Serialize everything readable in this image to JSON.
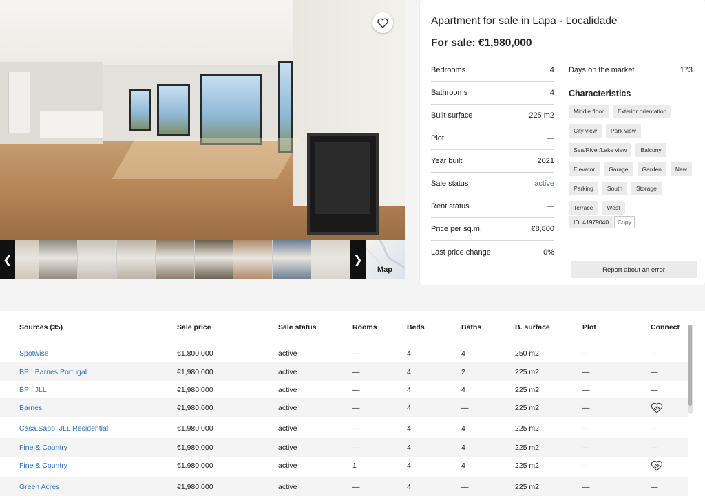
{
  "listing": {
    "title": "Apartment for sale in Lapa - Localidade",
    "price": "For sale: €1,980,000",
    "facts": [
      {
        "label": "Bedrooms",
        "value": "4"
      },
      {
        "label": "Bathrooms",
        "value": "4"
      },
      {
        "label": "Built surface",
        "value": "225 m2"
      },
      {
        "label": "Plot",
        "value": "—"
      },
      {
        "label": "Year built",
        "value": "2021"
      },
      {
        "label": "Sale status",
        "value": "active"
      },
      {
        "label": "Rent status",
        "value": "—"
      },
      {
        "label": "Price per sq.m.",
        "value": "€8,800"
      },
      {
        "label": "Last price change",
        "value": "0%"
      }
    ],
    "days_on_market": {
      "label": "Days on the market",
      "value": "173"
    },
    "characteristics_title": "Characteristics",
    "characteristics": [
      "Middle floor",
      "Exterior orientation",
      "City view",
      "Park view",
      "Sea/River/Lake view",
      "Balcony",
      "Elevator",
      "Garage",
      "Garden",
      "New",
      "Parking",
      "South",
      "Storage",
      "Terrace",
      "West"
    ],
    "id_label": "ID: 41979040",
    "copy_label": "Copy",
    "report_label": "Report about an error",
    "link_color": "#2f72c4"
  },
  "gallery": {
    "map_label": "Map",
    "prev_icon": "chevron-left-icon",
    "next_icon": "chevron-right-icon",
    "favorite_icon": "heart-icon",
    "thumb_colors": [
      "#cfc6b8",
      "#8f8a7f",
      "#c7c2b8",
      "#b9b2a4",
      "#8a7b66",
      "#6b5f50",
      "#b08a6a",
      "#6c7f92",
      "#d8d4cc"
    ]
  },
  "sources": {
    "headers": [
      "Sources (35)",
      "Sale price",
      "Sale status",
      "Rooms",
      "Beds",
      "Baths",
      "B. surface",
      "Plot",
      "Connect"
    ],
    "rows": [
      {
        "name": "Spotwise",
        "price": "€1,800,000",
        "status": "active",
        "rooms": "—",
        "beds": "4",
        "baths": "4",
        "surface": "250 m2",
        "plot": "—",
        "connect": "—"
      },
      {
        "name": "BPI: Barnes Portugal",
        "price": "€1,980,000",
        "status": "active",
        "rooms": "—",
        "beds": "4",
        "baths": "2",
        "surface": "225 m2",
        "plot": "—",
        "connect": "—"
      },
      {
        "name": "BPI: JLL",
        "price": "€1,980,000",
        "status": "active",
        "rooms": "—",
        "beds": "4",
        "baths": "4",
        "surface": "225 m2",
        "plot": "—",
        "connect": "—"
      },
      {
        "name": "Barnes",
        "price": "€1,980,000",
        "status": "active",
        "rooms": "—",
        "beds": "4",
        "baths": "—",
        "surface": "225 m2",
        "plot": "—",
        "connect": "handshake-icon"
      },
      {
        "name": "Casa.Sapo: JLL Residential",
        "price": "€1,980,000",
        "status": "active",
        "rooms": "—",
        "beds": "4",
        "baths": "4",
        "surface": "225 m2",
        "plot": "—",
        "connect": "—"
      },
      {
        "name": "Fine & Country",
        "price": "€1,980,000",
        "status": "active",
        "rooms": "—",
        "beds": "4",
        "baths": "4",
        "surface": "225 m2",
        "plot": "—",
        "connect": "—"
      },
      {
        "name": "Fine & Country",
        "price": "€1,980,000",
        "status": "active",
        "rooms": "1",
        "beds": "4",
        "baths": "4",
        "surface": "225 m2",
        "plot": "—",
        "connect": "handshake-icon"
      },
      {
        "name": "Green Acres",
        "price": "€1,980,000",
        "status": "active",
        "rooms": "—",
        "beds": "4",
        "baths": "—",
        "surface": "225 m2",
        "plot": "—",
        "connect": "—"
      }
    ]
  }
}
